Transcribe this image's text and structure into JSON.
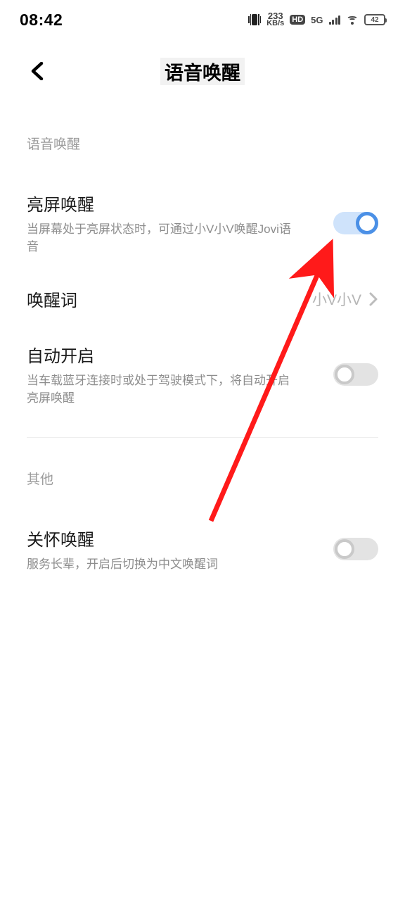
{
  "status": {
    "time": "08:42",
    "net_speed_value": "233",
    "net_speed_unit": "KB/s",
    "hd": "HD",
    "net_type": "5G",
    "battery_pct": "42"
  },
  "header": {
    "title": "语音唤醒"
  },
  "section_voice": {
    "label": "语音唤醒",
    "screen_on": {
      "title": "亮屏唤醒",
      "sub": "当屏幕处于亮屏状态时，可通过小V小V唤醒Jovi语音"
    },
    "wake_word": {
      "title": "唤醒词",
      "value": "小V小V"
    },
    "auto_on": {
      "title": "自动开启",
      "sub": "当车载蓝牙连接时或处于驾驶模式下，将自动开启亮屏唤醒"
    }
  },
  "section_other": {
    "label": "其他",
    "care": {
      "title": "关怀唤醒",
      "sub": "服务长辈，开启后切换为中文唤醒词"
    }
  }
}
